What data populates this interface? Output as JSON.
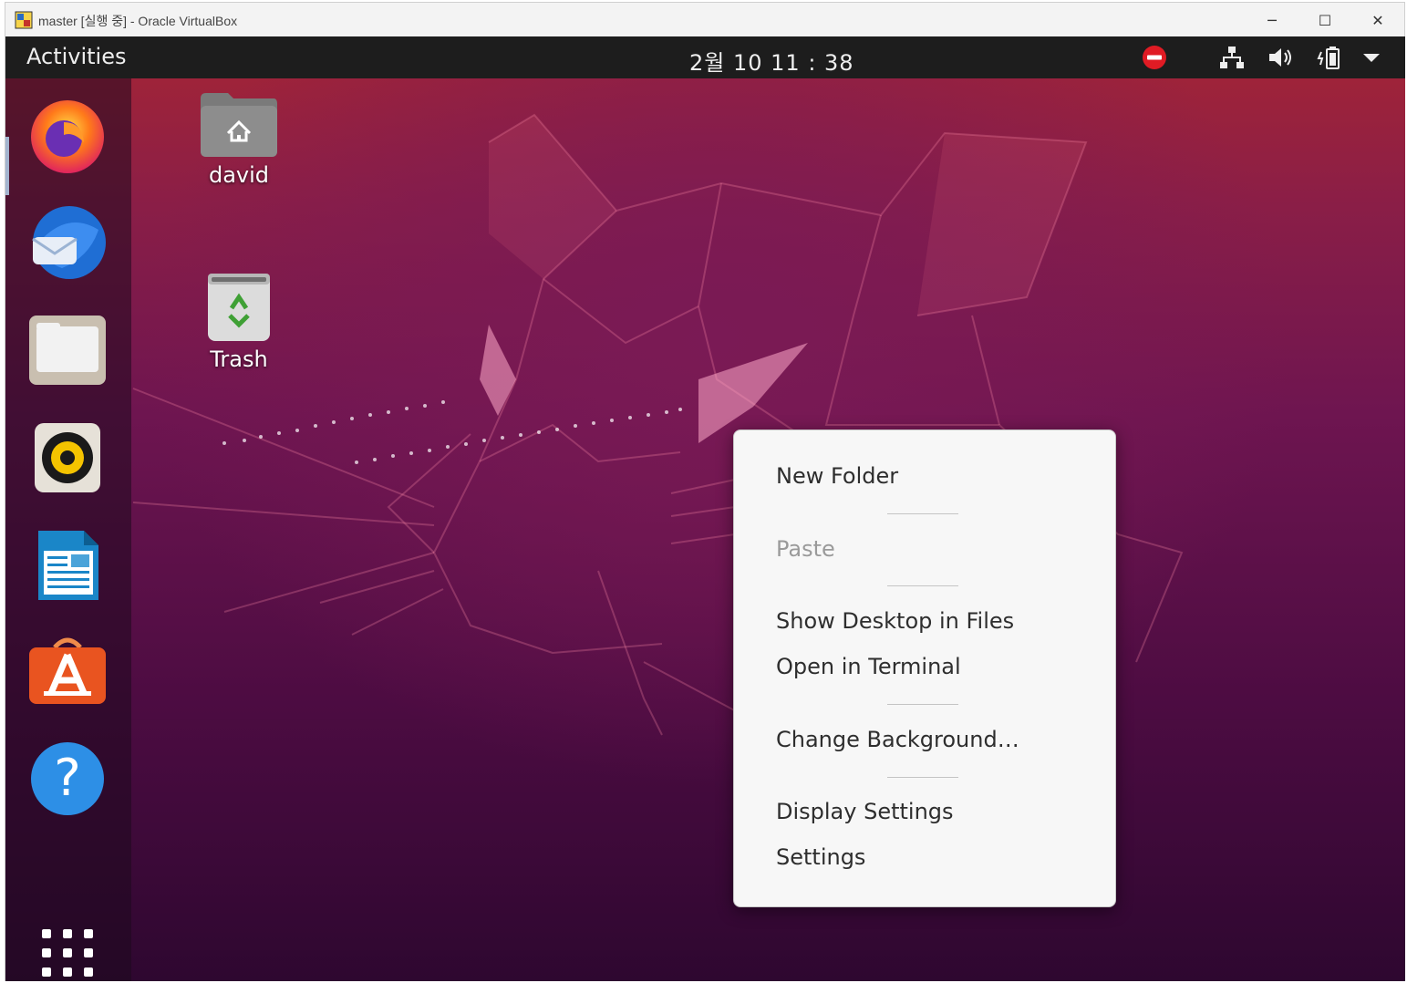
{
  "window": {
    "title": "master [실행 중] - Oracle VirtualBox",
    "controls": {
      "minimize": "─",
      "maximize": "☐",
      "close": "✕"
    }
  },
  "topbar": {
    "activities": "Activities",
    "clock": "2월 10  11 : 38",
    "tray_icons": [
      "do-not-disturb-icon",
      "network-icon",
      "volume-icon",
      "battery-icon",
      "system-menu-chevron-icon"
    ]
  },
  "dock": {
    "items": [
      "firefox-icon",
      "thunderbird-icon",
      "files-icon",
      "rhythmbox-icon",
      "libreoffice-writer-icon",
      "software-center-icon",
      "help-icon",
      "show-applications-icon"
    ]
  },
  "desktop": {
    "icons": [
      {
        "label": "david",
        "icon": "home-folder-icon"
      },
      {
        "label": "Trash",
        "icon": "trash-icon"
      }
    ]
  },
  "context_menu": {
    "items": [
      {
        "label": "New Folder",
        "enabled": true
      },
      {
        "label": "Paste",
        "enabled": false
      },
      {
        "label": "Show Desktop in Files",
        "enabled": true
      },
      {
        "label": "Open in Terminal",
        "enabled": true
      },
      {
        "label": "Change Background…",
        "enabled": true
      },
      {
        "label": "Display Settings",
        "enabled": true
      },
      {
        "label": "Settings",
        "enabled": true
      }
    ]
  },
  "colors": {
    "topbar": "#1d1d1d",
    "menu_bg": "#f7f7f7",
    "wallpaper_top": "#a52535",
    "wallpaper_bottom": "#2e0730"
  }
}
